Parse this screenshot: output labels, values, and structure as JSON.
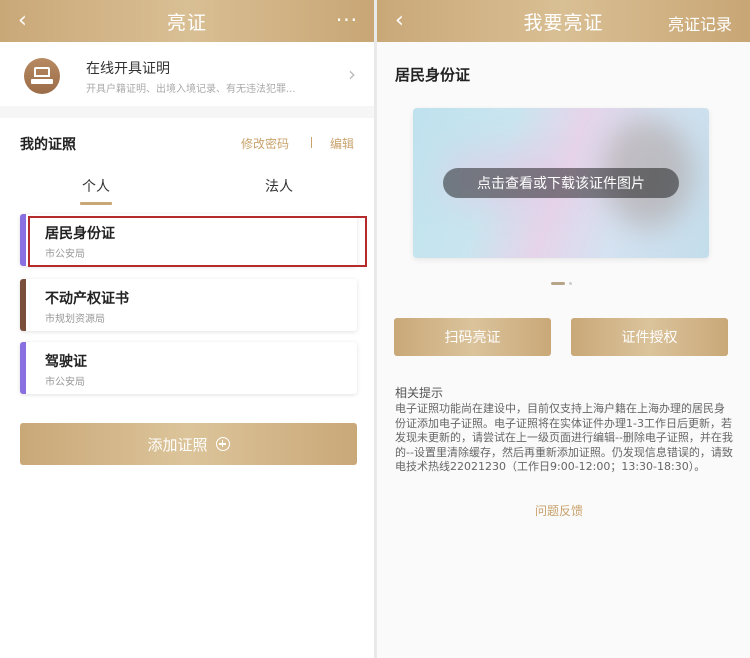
{
  "left": {
    "nav": {
      "back": "‹",
      "title": "亮证",
      "more": "···"
    },
    "online": {
      "title": "在线开具证明",
      "subtitle": "开具户籍证明、出境入境记录、有无违法犯罪...",
      "chevron": "›"
    },
    "my_certs": {
      "title": "我的证照",
      "change_password": "修改密码",
      "separator": "|",
      "edit": "编辑",
      "tabs": [
        "个人",
        "法人"
      ],
      "active_tab": "个人",
      "certs": [
        {
          "name": "居民身份证",
          "issuer": "市公安局",
          "color": "#8a6fe0",
          "selected": true
        },
        {
          "name": "不动产权证书",
          "issuer": "市规划资源局",
          "color": "#7a4f3c",
          "selected": false
        },
        {
          "name": "驾驶证",
          "issuer": "市公安局",
          "color": "#8a6fe0",
          "selected": false
        }
      ],
      "add_button": "添加证照"
    }
  },
  "right": {
    "nav": {
      "back": "‹",
      "title": "我要亮证",
      "records": "亮证记录"
    },
    "id_title": "居民身份证",
    "image_caption": "点击查看或下载该证件图片",
    "buttons": {
      "scan": "扫码亮证",
      "authorize": "证件授权"
    },
    "tips": {
      "title": "相关提示",
      "body": "电子证照功能尚在建设中，目前仅支持上海户籍在上海办理的居民身份证添加电子证照。电子证照将在实体证件办理1-3工作日后更新，若发现未更新的，请尝试在上一级页面进行编辑--删除电子证照，并在我的--设置里清除缓存，然后再重新添加证照。仍发现信息错误的，请致电技术热线22021230（工作日9:00-12:00；13:30-18:30）。"
    },
    "feedback": "问题反馈"
  }
}
